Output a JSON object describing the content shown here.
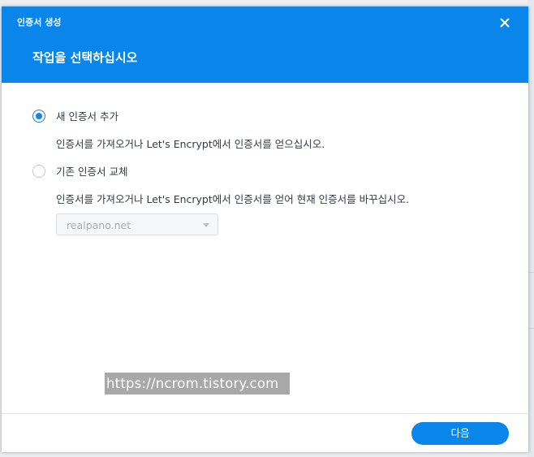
{
  "dialog": {
    "window_title": "인증서 생성",
    "header_title": "작업을 선택하십시오",
    "close_icon": "close-icon"
  },
  "options": [
    {
      "label": "새 인증서 추가",
      "description": "인증서를 가져오거나 Let's Encrypt에서 인증서를 얻으십시오.",
      "checked": true
    },
    {
      "label": "기존 인증서 교체",
      "description": "인증서를 가져오거나 Let's Encrypt에서 인증서를 얻어 현재 인증서를 바꾸십시오.",
      "checked": false
    }
  ],
  "certificate_select": {
    "value": "realpano.net",
    "disabled": true
  },
  "watermark": {
    "text": "https://ncrom.tistory.com"
  },
  "footer": {
    "next_label": "다음"
  },
  "colors": {
    "accent": "#0a85ea",
    "text": "#333a44",
    "disabled_text": "#a6adb5"
  }
}
